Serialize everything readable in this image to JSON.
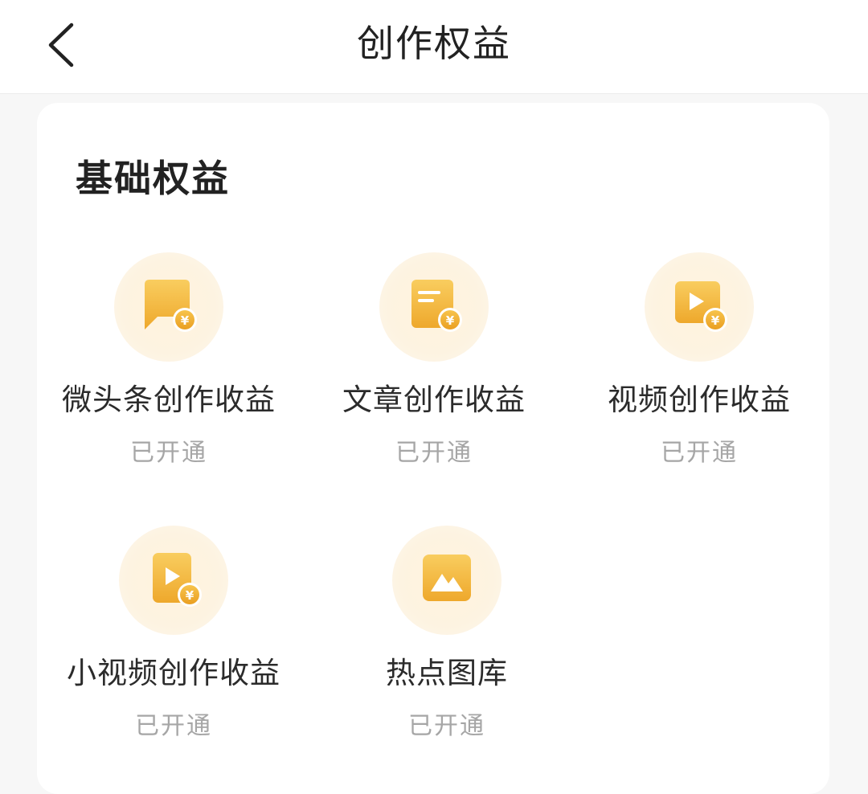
{
  "header": {
    "back_icon": "chevron-left-icon",
    "title": "创作权益"
  },
  "section": {
    "title": "基础权益",
    "items": [
      {
        "label": "微头条创作收益",
        "status": "已开通",
        "icon": "chat-bubble-yuan-icon"
      },
      {
        "label": "文章创作收益",
        "status": "已开通",
        "icon": "article-yuan-icon"
      },
      {
        "label": "视频创作收益",
        "status": "已开通",
        "icon": "video-yuan-icon"
      },
      {
        "label": "小视频创作收益",
        "status": "已开通",
        "icon": "short-video-yuan-icon"
      },
      {
        "label": "热点图库",
        "status": "已开通",
        "icon": "image-gallery-icon"
      }
    ]
  },
  "colors": {
    "icon_gold": "#f2b63a",
    "icon_circle": "#fdf3e1",
    "status_gray": "#a6a6a6"
  }
}
